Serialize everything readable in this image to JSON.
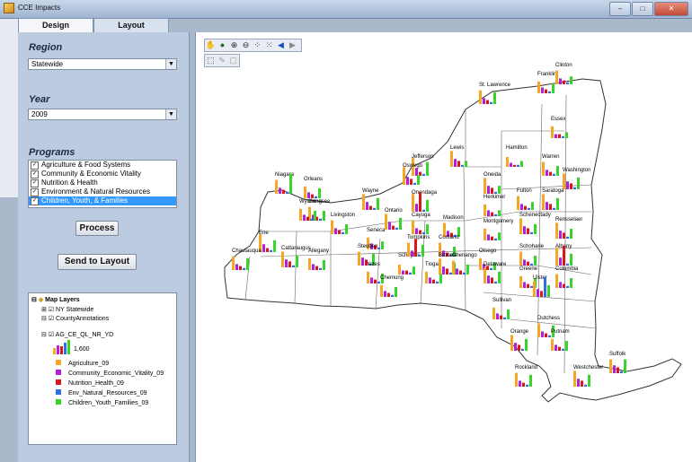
{
  "window": {
    "title": "CCE Impacts",
    "minimize": "–",
    "maximize": "□",
    "close": "✕"
  },
  "tabs": [
    {
      "label": "Design"
    },
    {
      "label": "Layout"
    }
  ],
  "region": {
    "label": "Region",
    "value": "Statewide"
  },
  "year": {
    "label": "Year",
    "value": "2009"
  },
  "programs": {
    "label": "Programs",
    "items": [
      {
        "label": "Agriculture & Food Systems",
        "checked": true
      },
      {
        "label": "Community & Economic Vitality",
        "checked": true
      },
      {
        "label": "Nutrition & Health",
        "checked": true
      },
      {
        "label": "Environment & Natural Resources",
        "checked": true
      },
      {
        "label": "Children, Youth, & Families",
        "checked": true,
        "selected": true
      }
    ]
  },
  "buttons": {
    "process": "Process",
    "send_to_layout": "Send to Layout"
  },
  "legend": {
    "root": "Map Layers",
    "layers": [
      "NY Statewide",
      "CountyAnnotations",
      "AG_CE_QL_NR_YD"
    ],
    "scale_value": "1,600",
    "items": [
      {
        "label": "Agriculture_09",
        "color": "#f5a623"
      },
      {
        "label": "Community_Economic_Vitality_09",
        "color": "#b21fd6"
      },
      {
        "label": "Nutrition_Health_09",
        "color": "#d9181b"
      },
      {
        "label": "Env_Natural_Resources_09",
        "color": "#2f6fe0"
      },
      {
        "label": "Children_Youth_Families_09",
        "color": "#38d42b"
      }
    ]
  },
  "map": {
    "tools": [
      "pan-icon",
      "globe-icon",
      "zoom-in-icon",
      "zoom-out-icon",
      "full-extent-icon",
      "extent-icon",
      "back-icon",
      "forward-icon"
    ],
    "counties": [
      {
        "name": "St. Lawrence",
        "bars": [
          0.7,
          0.3,
          0.2,
          0.1,
          0.6
        ]
      },
      {
        "name": "Franklin",
        "bars": [
          0.6,
          0.3,
          0.2,
          0.1,
          0.5
        ]
      },
      {
        "name": "Clinton",
        "bars": [
          0.7,
          0.3,
          0.2,
          0.1,
          0.4
        ]
      },
      {
        "name": "Jefferson",
        "bars": [
          0.9,
          0.4,
          0.2,
          0.1,
          0.7
        ]
      },
      {
        "name": "Lewis",
        "bars": [
          0.8,
          0.4,
          0.3,
          0.1,
          0.3
        ]
      },
      {
        "name": "Essex",
        "bars": [
          0.6,
          0.2,
          0.2,
          0.1,
          0.3
        ]
      },
      {
        "name": "Hamilton",
        "bars": [
          0.5,
          0.2,
          0.1,
          0.1,
          0.3
        ]
      },
      {
        "name": "Warren",
        "bars": [
          0.7,
          0.3,
          0.2,
          0.1,
          0.5
        ]
      },
      {
        "name": "Washington",
        "bars": [
          0.8,
          0.4,
          0.3,
          0.1,
          0.6
        ]
      },
      {
        "name": "Niagara",
        "bars": [
          0.7,
          0.3,
          0.2,
          0.1,
          1.0
        ]
      },
      {
        "name": "Orleans",
        "bars": [
          0.6,
          0.3,
          0.2,
          0.1,
          0.5
        ]
      },
      {
        "name": "Genesee",
        "bars": [
          0.7,
          0.3,
          0.2,
          0.1,
          0.5
        ]
      },
      {
        "name": "Wayne",
        "bars": [
          0.8,
          0.4,
          0.2,
          0.1,
          0.6
        ]
      },
      {
        "name": "Oswego",
        "bars": [
          0.9,
          0.4,
          0.3,
          0.1,
          0.5
        ]
      },
      {
        "name": "Oneida",
        "bars": [
          0.8,
          0.4,
          0.3,
          0.1,
          0.4
        ]
      },
      {
        "name": "Herkimer",
        "bars": [
          0.6,
          0.3,
          0.2,
          0.1,
          0.3
        ]
      },
      {
        "name": "Fulton",
        "bars": [
          0.7,
          0.3,
          0.2,
          0.1,
          0.4
        ]
      },
      {
        "name": "Saratoga",
        "bars": [
          0.8,
          0.4,
          0.3,
          0.1,
          0.6
        ]
      },
      {
        "name": "Erie",
        "bars": [
          0.9,
          0.4,
          0.2,
          0.1,
          0.6
        ]
      },
      {
        "name": "Wyoming",
        "bars": [
          0.6,
          0.3,
          0.2,
          0.1,
          0.5
        ]
      },
      {
        "name": "Livingston",
        "bars": [
          0.7,
          0.3,
          0.2,
          0.1,
          0.5
        ]
      },
      {
        "name": "Ontario",
        "bars": [
          0.8,
          0.4,
          0.2,
          0.1,
          0.6
        ]
      },
      {
        "name": "Seneca",
        "bars": [
          0.6,
          0.3,
          0.2,
          0.1,
          0.4
        ]
      },
      {
        "name": "Cayuga",
        "bars": [
          0.7,
          0.3,
          0.2,
          0.1,
          0.5
        ]
      },
      {
        "name": "Onondaga",
        "bars": [
          0.9,
          0.4,
          1.0,
          0.1,
          0.6
        ]
      },
      {
        "name": "Madison",
        "bars": [
          0.7,
          0.3,
          0.2,
          0.1,
          0.5
        ]
      },
      {
        "name": "Montgomery",
        "bars": [
          0.6,
          0.3,
          0.2,
          0.1,
          0.4
        ]
      },
      {
        "name": "Schenectady",
        "bars": [
          0.8,
          0.4,
          0.3,
          0.1,
          0.5
        ]
      },
      {
        "name": "Rensselaer",
        "bars": [
          0.8,
          0.4,
          0.3,
          0.1,
          0.5
        ]
      },
      {
        "name": "Chautauqua",
        "bars": [
          0.7,
          0.3,
          0.2,
          0.1,
          0.6
        ]
      },
      {
        "name": "Cattaraugus",
        "bars": [
          0.8,
          0.4,
          0.3,
          0.1,
          0.6
        ]
      },
      {
        "name": "Allegany",
        "bars": [
          0.6,
          0.3,
          0.2,
          0.1,
          0.5
        ]
      },
      {
        "name": "Steuben",
        "bars": [
          0.7,
          0.4,
          0.3,
          0.1,
          0.6
        ]
      },
      {
        "name": "Yates",
        "bars": [
          0.6,
          0.3,
          0.2,
          0.1,
          0.5
        ]
      },
      {
        "name": "Schuyler",
        "bars": [
          0.5,
          0.2,
          0.2,
          0.1,
          0.4
        ]
      },
      {
        "name": "Chemung",
        "bars": [
          0.6,
          0.3,
          0.2,
          0.1,
          0.5
        ]
      },
      {
        "name": "Tompkins",
        "bars": [
          0.7,
          0.3,
          0.9,
          0.1,
          0.6
        ]
      },
      {
        "name": "Tioga",
        "bars": [
          0.6,
          0.3,
          0.2,
          0.1,
          0.5
        ]
      },
      {
        "name": "Cortland",
        "bars": [
          0.7,
          0.3,
          0.2,
          0.1,
          0.5
        ]
      },
      {
        "name": "Broome",
        "bars": [
          0.8,
          0.4,
          0.3,
          0.1,
          0.6
        ]
      },
      {
        "name": "Chenango",
        "bars": [
          0.7,
          0.3,
          0.2,
          0.1,
          0.5
        ]
      },
      {
        "name": "Otsego",
        "bars": [
          0.6,
          0.3,
          0.2,
          0.1,
          0.4
        ]
      },
      {
        "name": "Delaware",
        "bars": [
          0.8,
          0.4,
          0.3,
          0.1,
          0.6
        ]
      },
      {
        "name": "Schoharie",
        "bars": [
          0.7,
          0.3,
          0.2,
          0.1,
          0.5
        ]
      },
      {
        "name": "Albany",
        "bars": [
          0.9,
          0.4,
          1.0,
          0.1,
          0.6
        ]
      },
      {
        "name": "Greene",
        "bars": [
          0.6,
          0.3,
          0.2,
          0.1,
          0.5
        ]
      },
      {
        "name": "Columbia",
        "bars": [
          0.7,
          0.3,
          0.2,
          0.1,
          0.5
        ]
      },
      {
        "name": "Ulster",
        "bars": [
          0.8,
          0.4,
          0.3,
          1.0,
          0.6
        ]
      },
      {
        "name": "Sullivan",
        "bars": [
          0.6,
          0.3,
          0.2,
          0.1,
          0.5
        ]
      },
      {
        "name": "Dutchess",
        "bars": [
          0.7,
          0.3,
          0.2,
          0.1,
          0.6
        ]
      },
      {
        "name": "Orange",
        "bars": [
          0.8,
          0.4,
          0.3,
          0.1,
          0.6
        ]
      },
      {
        "name": "Putnam",
        "bars": [
          0.6,
          0.3,
          0.2,
          0.1,
          0.5
        ]
      },
      {
        "name": "Rockland",
        "bars": [
          0.7,
          0.3,
          0.2,
          0.1,
          0.6
        ]
      },
      {
        "name": "Westchester",
        "bars": [
          0.8,
          0.4,
          0.3,
          0.1,
          0.6
        ]
      },
      {
        "name": "Suffolk",
        "bars": [
          0.7,
          0.4,
          0.3,
          0.1,
          0.7
        ]
      }
    ]
  }
}
